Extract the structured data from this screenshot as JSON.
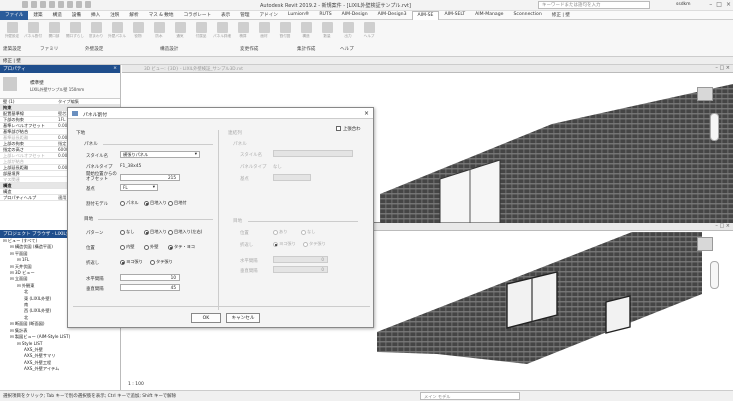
{
  "titlebar": {
    "title": "Autodesk Revit 2019.2 - 新規案件 - [LIXIL外壁検証サンプル.rvt]",
    "search_placeholder": "キーワードまたは語句を入力",
    "user": "ssdkm"
  },
  "menu": [
    "ファイル",
    "建築",
    "構造",
    "設備",
    "挿入",
    "注釈",
    "解析",
    "マス & 敷地",
    "コラボレート",
    "表示",
    "管理",
    "アドイン",
    "Lumion®",
    "RUTS",
    "AIM-Design",
    "AIM-Design3",
    "AIM-SE",
    "AIM-SELT",
    "AIM-Manage",
    "Sconnection",
    "修正 | 壁"
  ],
  "menu_active_index": 16,
  "ribbon": {
    "buttons": [
      "外壁設定",
      "パネル割付",
      "開口部",
      "開口ずらし",
      "窓まわり",
      "外壁パネル",
      "役物",
      "防水",
      "通気",
      "付属品",
      "パネル詳細",
      "積算",
      "面材",
      "割付図",
      "構造",
      "数量",
      "出力",
      "ヘルプ"
    ],
    "groups": [
      "建築設定",
      "ファミリ",
      "外壁設定",
      "構造設計",
      "変更作成",
      "集計作成",
      "ヘルプ"
    ]
  },
  "context_bar": "修正 | 壁",
  "properties": {
    "title": "プロパティ",
    "type_name": "標準壁",
    "type_sub": "LIXIL外壁サンプル壁 150mm",
    "filter": "壁 (1)",
    "edit_type": "タイプ編集",
    "rows": [
      {
        "k": "拘束",
        "v": "",
        "cat": true
      },
      {
        "k": "配置基準線",
        "v": "壁芯"
      },
      {
        "k": "下部の拘束",
        "v": "1FL"
      },
      {
        "k": "基準レベルオフセット",
        "v": "0.000"
      },
      {
        "k": "基準部が結合",
        "v": ""
      },
      {
        "k": "基準延長距離",
        "v": "0.000",
        "dim": true
      },
      {
        "k": "上部の拘束",
        "v": "指定"
      },
      {
        "k": "指定の高さ",
        "v": "6000.0"
      },
      {
        "k": "上部レベルオフセット",
        "v": "0.000",
        "dim": true
      },
      {
        "k": "上部が結合",
        "v": "",
        "dim": true
      },
      {
        "k": "上部延長距離",
        "v": "0.000"
      },
      {
        "k": "部屋境界",
        "v": ""
      },
      {
        "k": "マス関連",
        "v": "",
        "dim": true
      },
      {
        "k": "構造",
        "v": "",
        "cat": true
      },
      {
        "k": "構造",
        "v": ""
      },
      {
        "k": "プロパティヘルプ",
        "v": "適用"
      }
    ]
  },
  "browser": {
    "title": "プロジェクト ブラウザ - LIXIL外壁検証サンプル.rvt",
    "items": [
      {
        "t": "ビュー (すべて)",
        "d": 0
      },
      {
        "t": "構造伏図 (構造平面)",
        "d": 1
      },
      {
        "t": "平面図",
        "d": 1
      },
      {
        "t": "1FL",
        "d": 2
      },
      {
        "t": "天井伏図",
        "d": 1
      },
      {
        "t": "3D ビュー",
        "d": 1
      },
      {
        "t": "立面図",
        "d": 1
      },
      {
        "t": "外観東",
        "d": 2
      },
      {
        "t": "北",
        "d": 3
      },
      {
        "t": "東 (LIXIL外壁)",
        "d": 3
      },
      {
        "t": "南",
        "d": 3
      },
      {
        "t": "西 (LIXIL外壁)",
        "d": 3
      },
      {
        "t": "北",
        "d": 3
      },
      {
        "t": "断面図 (断面図)",
        "d": 1
      },
      {
        "t": "集計表",
        "d": 1
      },
      {
        "t": "製図ビュー (AIM-Style LIST)",
        "d": 1
      },
      {
        "t": "Style LIST",
        "d": 2
      },
      {
        "t": "AXS_外壁",
        "d": 3
      },
      {
        "t": "AXS_外壁サマリ",
        "d": 3
      },
      {
        "t": "AXS_外壁工程",
        "d": 3
      },
      {
        "t": "AXS_外壁アイテム",
        "d": 3
      }
    ]
  },
  "views": {
    "top_title": "3D ビュー: {3D} - LIXIL外壁検証_サンプル3D.rvt",
    "bottom_title": "3D ビュー: LIXIL外壁_3D",
    "view_scale": "1 : 100"
  },
  "dialog": {
    "title": "パネル割付",
    "close": "×",
    "left_header": "下地",
    "panel_section": "パネル",
    "style_label": "スタイル名",
    "style_value": "横張りパネル",
    "panel_type_label": "パネルタイプ",
    "panel_type_value": "F1_38x45",
    "offset_label": "開始位置からのオフセット",
    "offset_value": "215",
    "base_label": "基点",
    "base_value": "FL",
    "direction_label": "割付モデル",
    "direction_options": [
      "パネル",
      "目地入り",
      "目地付"
    ],
    "direction_selected": 1,
    "joint_section": "目地",
    "pattern_label": "パターン",
    "pattern_options": [
      "なし",
      "目地入り",
      "目地入り(左右)"
    ],
    "pattern_selected": 1,
    "position_label": "位置",
    "position_options": [
      "内壁",
      "外壁",
      "タテ・ヨコ"
    ],
    "position_selected": 2,
    "fold_label": "折返し",
    "fold_options": [
      "ヨコ張り",
      "タテ張り"
    ],
    "fold_selected": 0,
    "hgap_label": "水平間隔",
    "hgap_value": "10",
    "vgap_label": "垂直間隔",
    "vgap_value": "45",
    "right_header": "連結列",
    "same_check": "上張合わ",
    "r_panel_section": "パネル",
    "r_style_label": "スタイル名",
    "r_type_label": "パネルタイプ",
    "r_type_value": "なし",
    "r_base_label": "基点",
    "r_joint_section": "目地",
    "r_pos_label": "位置",
    "r_pos_options": [
      "あり",
      "なし"
    ],
    "r_fold_label": "折返し",
    "r_fold_options": [
      "ヨコ張り",
      "タテ張り"
    ],
    "r_hgap_label": "水平間隔",
    "r_hgap_value": "0",
    "r_vgap_label": "垂直間隔",
    "r_vgap_value": "0",
    "ok": "OK",
    "cancel": "キャンセル"
  },
  "status": {
    "left": "選択項目をクリック; Tab キーで別の選択肢を表示; Ctrl キーで追加; Shift キーで解除",
    "right": "メイン モデル"
  }
}
